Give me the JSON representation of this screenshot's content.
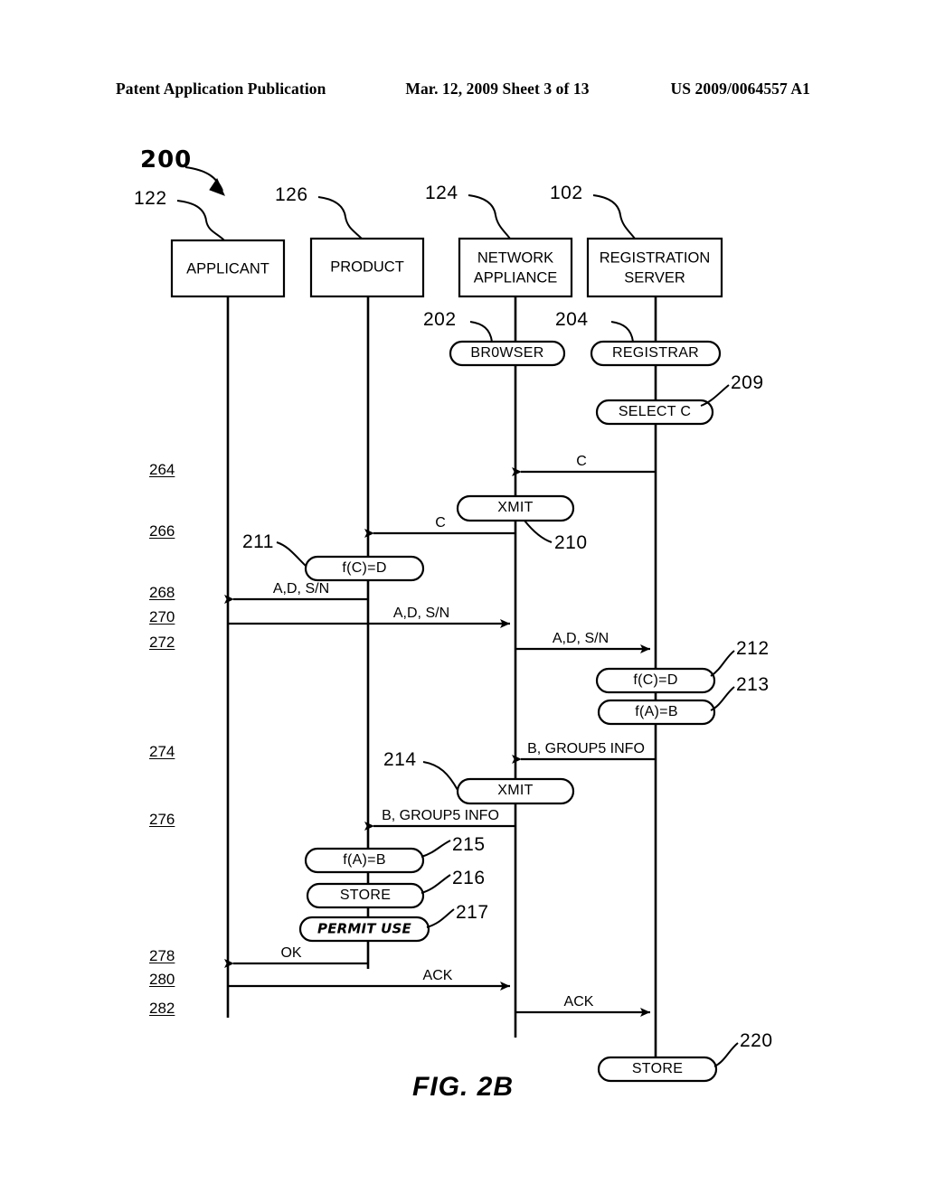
{
  "header": {
    "left": "Patent Application Publication",
    "middle": "Mar. 12, 2009  Sheet 3 of 13",
    "right": "US 2009/0064557 A1"
  },
  "figure": {
    "caption": "FIG. 2B",
    "diagram_ref": "200",
    "actors": [
      {
        "ref": "122",
        "label": "APPLICANT",
        "label_line2": ""
      },
      {
        "ref": "126",
        "label": "PRODUCT",
        "label_line2": ""
      },
      {
        "ref": "124",
        "label": "NETWORK",
        "label_line2": "APPLIANCE"
      },
      {
        "ref": "102",
        "label": "REGISTRATION",
        "label_line2": "SERVER"
      }
    ],
    "process_pills": [
      {
        "ref": "202",
        "label": "BR0WSER",
        "lane": "network-appliance"
      },
      {
        "ref": "204",
        "label": "REGISTRAR",
        "lane": "registration-server"
      },
      {
        "ref": "209",
        "label": "SELECT C",
        "lane": "registration-server"
      },
      {
        "ref": "210",
        "label": "XMIT",
        "lane": "network-appliance"
      },
      {
        "ref": "211",
        "label": "f(C)=D",
        "lane": "product"
      },
      {
        "ref": "212",
        "label": "f(C)=D",
        "lane": "registration-server"
      },
      {
        "ref": "213",
        "label": "f(A)=B",
        "lane": "registration-server"
      },
      {
        "ref": "214",
        "label": "XMIT",
        "lane": "network-appliance"
      },
      {
        "ref": "215",
        "label": "f(A)=B",
        "lane": "product"
      },
      {
        "ref": "216",
        "label": "STORE",
        "lane": "product"
      },
      {
        "ref": "217",
        "label": "PERMIT USE",
        "lane": "product",
        "style": "handwritten"
      },
      {
        "ref": "220",
        "label": "STORE",
        "lane": "registration-server"
      }
    ],
    "messages": [
      {
        "step": "264",
        "label": "C",
        "from": "registration-server",
        "to": "network-appliance"
      },
      {
        "step": "266",
        "label": "C",
        "from": "network-appliance",
        "to": "product"
      },
      {
        "step": "268",
        "label": "A,D, S/N",
        "from": "product",
        "to": "applicant"
      },
      {
        "step": "270",
        "label": "A,D, S/N",
        "from": "applicant",
        "to": "network-appliance"
      },
      {
        "step": "272",
        "label": "A,D, S/N",
        "from": "network-appliance",
        "to": "registration-server"
      },
      {
        "step": "274",
        "label": "B, GROUP5 INFO",
        "from": "registration-server",
        "to": "network-appliance"
      },
      {
        "step": "276",
        "label": "B, GROUP5 INFO",
        "from": "network-appliance",
        "to": "product"
      },
      {
        "step": "278",
        "label": "OK",
        "from": "product",
        "to": "applicant"
      },
      {
        "step": "280",
        "label": "ACK",
        "from": "applicant",
        "to": "network-appliance"
      },
      {
        "step": "282",
        "label": "ACK",
        "from": "network-appliance",
        "to": "registration-server"
      }
    ]
  }
}
